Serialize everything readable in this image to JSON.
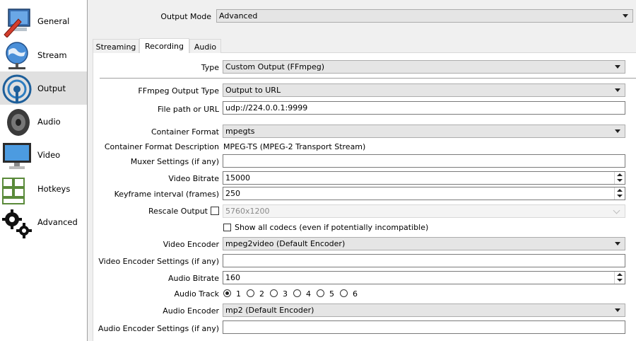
{
  "sidebar": {
    "items": [
      {
        "label": "General",
        "icon": "general-icon"
      },
      {
        "label": "Stream",
        "icon": "stream-icon"
      },
      {
        "label": "Output",
        "icon": "output-icon",
        "selected": true
      },
      {
        "label": "Audio",
        "icon": "speaker-icon"
      },
      {
        "label": "Video",
        "icon": "monitor-icon"
      },
      {
        "label": "Hotkeys",
        "icon": "keyboard-icon"
      },
      {
        "label": "Advanced",
        "icon": "gears-icon"
      }
    ]
  },
  "output_mode": {
    "label": "Output Mode",
    "value": "Advanced"
  },
  "tabs": [
    {
      "label": "Streaming"
    },
    {
      "label": "Recording",
      "active": true
    },
    {
      "label": "Audio"
    }
  ],
  "recording": {
    "type": {
      "label": "Type",
      "value": "Custom Output (FFmpeg)"
    },
    "ffmpeg_output_type": {
      "label": "FFmpeg Output Type",
      "value": "Output to URL"
    },
    "file_path": {
      "label": "File path or URL",
      "value": "udp://224.0.0.1:9999"
    },
    "container_format": {
      "label": "Container Format",
      "value": "mpegts"
    },
    "container_format_description": {
      "label": "Container Format Description",
      "value": "MPEG-TS (MPEG-2 Transport Stream)"
    },
    "muxer_settings": {
      "label": "Muxer Settings (if any)",
      "value": ""
    },
    "video_bitrate": {
      "label": "Video Bitrate",
      "value": "15000"
    },
    "keyframe_interval": {
      "label": "Keyframe interval (frames)",
      "value": "250"
    },
    "rescale_output": {
      "label": "Rescale Output",
      "checked": false,
      "value": "5760x1200"
    },
    "show_all_codecs": {
      "label": "Show all codecs (even if potentially incompatible)",
      "checked": false
    },
    "video_encoder": {
      "label": "Video Encoder",
      "value": "mpeg2video (Default Encoder)"
    },
    "video_encoder_settings": {
      "label": "Video Encoder Settings (if any)",
      "value": ""
    },
    "audio_bitrate": {
      "label": "Audio Bitrate",
      "value": "160"
    },
    "audio_track": {
      "label": "Audio Track",
      "options": [
        "1",
        "2",
        "3",
        "4",
        "5",
        "6"
      ],
      "selected": "1"
    },
    "audio_encoder": {
      "label": "Audio Encoder",
      "value": "mp2 (Default Encoder)"
    },
    "audio_encoder_settings": {
      "label": "Audio Encoder Settings (if any)",
      "value": ""
    }
  },
  "colors": {
    "sidebar_selected": "#e0e0e0",
    "combo_bg": "#e5e5e5",
    "panel_bg": "#ffffff"
  }
}
